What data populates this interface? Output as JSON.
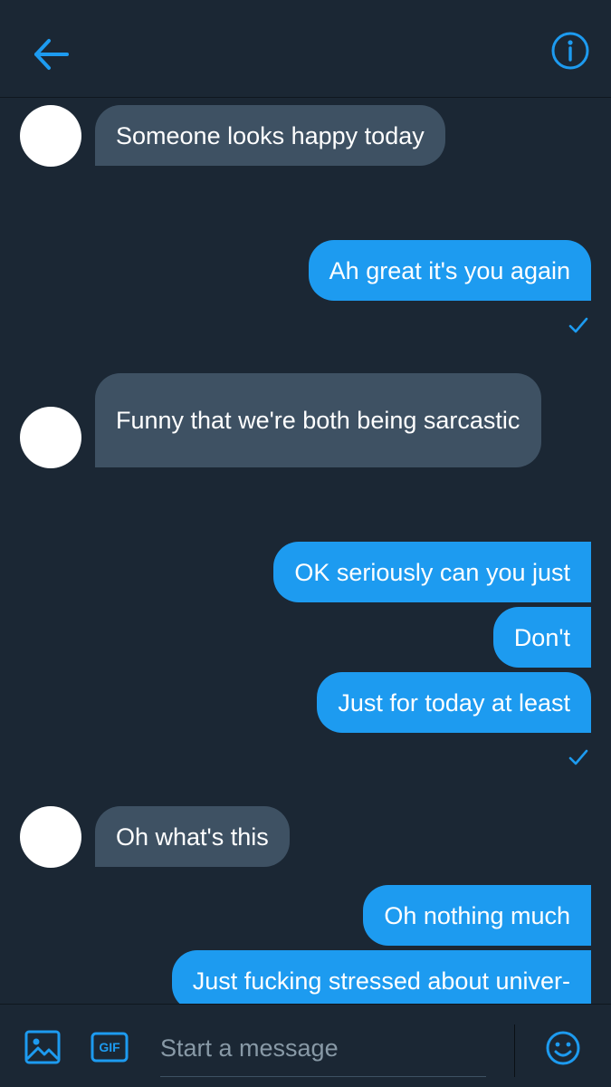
{
  "colors": {
    "background": "#1b2734",
    "incoming_bubble": "#3e5163",
    "outgoing_bubble": "#1d9bf0",
    "accent": "#1d9bf0",
    "placeholder": "#8899a6"
  },
  "header": {
    "back_icon": "arrow-left-icon",
    "info_icon": "info-icon"
  },
  "messages": [
    {
      "from": "them",
      "text": "Someone looks happy today"
    },
    {
      "from": "me",
      "text": "Ah great it's you again",
      "read": true
    },
    {
      "from": "them",
      "text": "Funny that we're both being sarcastic"
    },
    {
      "from": "me",
      "text": "OK seriously can you just"
    },
    {
      "from": "me",
      "text": "Don't"
    },
    {
      "from": "me",
      "text": "Just for today at least",
      "read": true
    },
    {
      "from": "them",
      "text": "Oh what's this"
    },
    {
      "from": "me",
      "text": "Oh nothing much"
    },
    {
      "from": "me",
      "text": "Just fucking stressed about univer-"
    }
  ],
  "composer": {
    "placeholder": "Start a message",
    "media_icon": "image-icon",
    "gif_label": "GIF",
    "emoji_icon": "emoji-icon"
  }
}
